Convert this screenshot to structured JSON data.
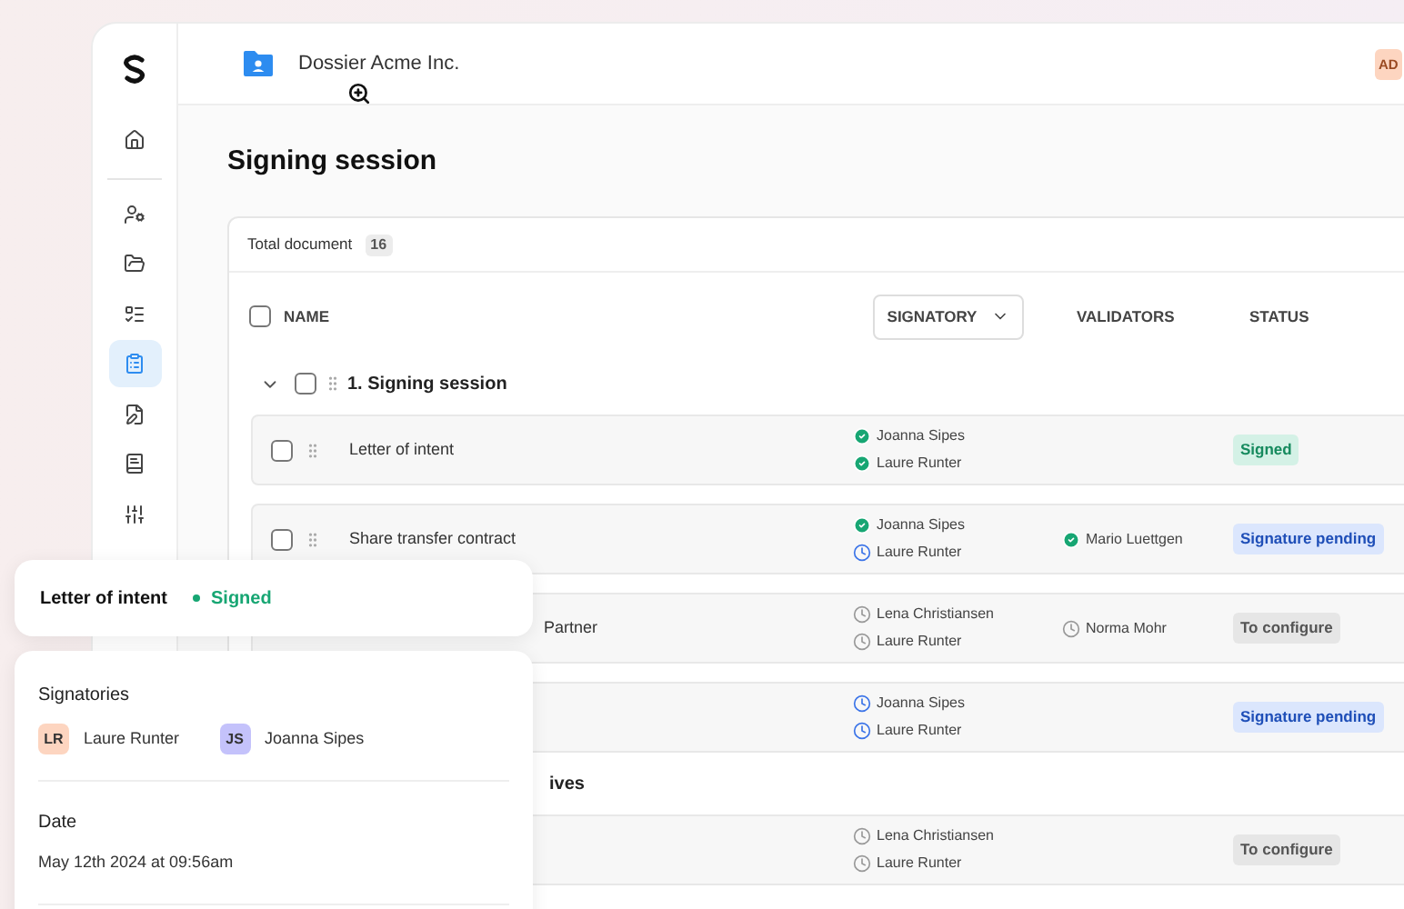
{
  "header": {
    "title": "Dossier Acme Inc.",
    "avatar": "AD"
  },
  "sidebar": {
    "items": [
      {
        "selected": false
      },
      {
        "selected": false
      },
      {
        "selected": false
      },
      {
        "selected": false
      },
      {
        "selected": true
      },
      {
        "selected": false
      },
      {
        "selected": false
      },
      {
        "selected": false
      }
    ]
  },
  "page": {
    "title": "Signing session"
  },
  "table": {
    "total_label": "Total document",
    "total_count": "16",
    "select_all_checked": false,
    "columns": {
      "name": "NAME",
      "signatory": "SIGNATORY",
      "validators": "VALIDATORS",
      "status": "STATUS"
    },
    "rows": [
      {
        "kind": "group",
        "name": "1. Signing session",
        "checked": false
      },
      {
        "kind": "doc",
        "name": "Letter of intent",
        "checked": false,
        "signatories": [
          {
            "name": "Joanna Sipes",
            "kind": "signed"
          },
          {
            "name": "Laure Runter",
            "kind": "signed"
          }
        ],
        "validators": [],
        "status": {
          "label": "Signed",
          "kind": "signed"
        }
      },
      {
        "kind": "doc",
        "name": "Share transfer contract",
        "checked": false,
        "signatories": [
          {
            "name": "Joanna Sipes",
            "kind": "signed"
          },
          {
            "name": "Laure Runter",
            "kind": "pending"
          }
        ],
        "validators": [
          {
            "name": "Mario Luettgen",
            "kind": "signed"
          }
        ],
        "status": {
          "label": "Signature pending",
          "kind": "pending"
        }
      },
      {
        "kind": "doc",
        "name": "Partner",
        "signatories": [
          {
            "name": "Lena Christiansen",
            "kind": "waiting"
          },
          {
            "name": "Laure Runter",
            "kind": "waiting"
          }
        ],
        "validators": [
          {
            "name": "Norma Mohr",
            "kind": "waiting"
          }
        ],
        "status": {
          "label": "To configure",
          "kind": "configure"
        }
      },
      {
        "kind": "doc",
        "signatories": [
          {
            "name": "Joanna Sipes",
            "kind": "pending"
          },
          {
            "name": "Laure Runter",
            "kind": "pending"
          }
        ],
        "validators": [],
        "status": {
          "label": "Signature pending",
          "kind": "pending"
        }
      },
      {
        "kind": "group",
        "name": "ives"
      },
      {
        "kind": "doc",
        "signatories": [
          {
            "name": "Lena Christiansen",
            "kind": "waiting"
          },
          {
            "name": "Laure Runter",
            "kind": "waiting"
          }
        ],
        "validators": [],
        "status": {
          "label": "To configure",
          "kind": "configure"
        }
      }
    ]
  },
  "detail": {
    "title": "Letter of intent",
    "status": "Signed",
    "signatories_label": "Signatories",
    "signatories": [
      {
        "initials": "LR",
        "name": "Laure Runter",
        "color": "#fdd5c0"
      },
      {
        "initials": "JS",
        "name": "Joanna Sipes",
        "color": "#c4c2fb"
      }
    ],
    "date_label": "Date",
    "date": "May 12th 2024 at 09:56am"
  }
}
